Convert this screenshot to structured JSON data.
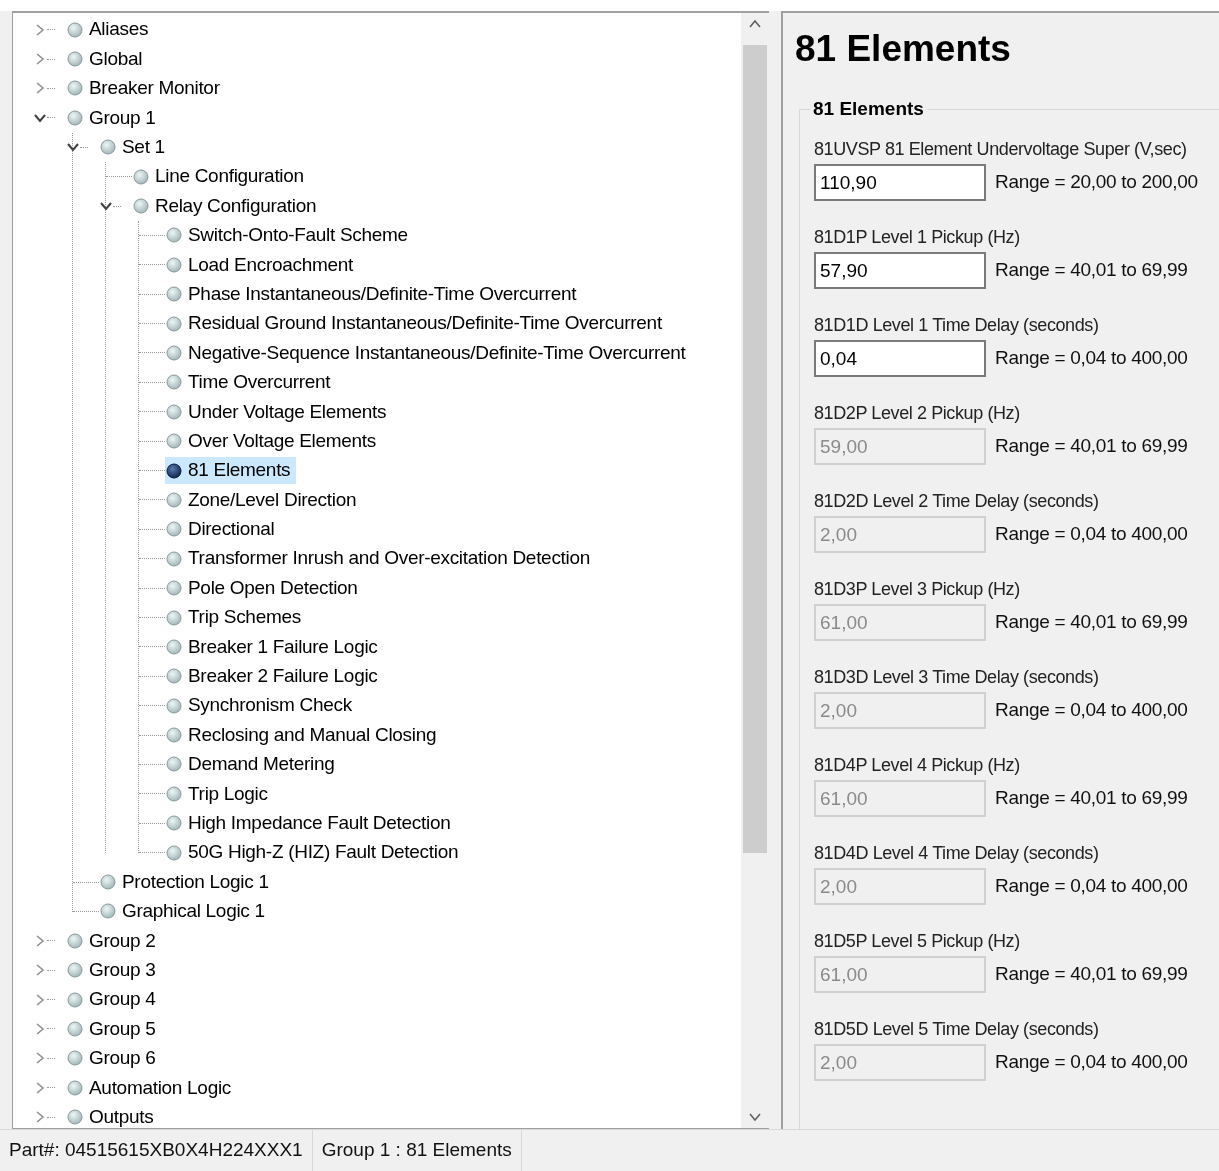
{
  "tree": [
    {
      "label": "Aliases",
      "expanded": false,
      "selected": false
    },
    {
      "label": "Global",
      "expanded": false,
      "selected": false
    },
    {
      "label": "Breaker Monitor",
      "expanded": false,
      "selected": false
    },
    {
      "label": "Group 1",
      "expanded": true,
      "selected": false,
      "children": [
        {
          "label": "Set 1",
          "expanded": true,
          "selected": false,
          "children": [
            {
              "label": "Line Configuration",
              "selected": false
            },
            {
              "label": "Relay Configuration",
              "expanded": true,
              "selected": false,
              "children": [
                {
                  "label": "Switch-Onto-Fault Scheme",
                  "selected": false
                },
                {
                  "label": "Load Encroachment",
                  "selected": false
                },
                {
                  "label": "Phase Instantaneous/Definite-Time Overcurrent",
                  "selected": false
                },
                {
                  "label": "Residual Ground Instantaneous/Definite-Time Overcurrent",
                  "selected": false
                },
                {
                  "label": "Negative-Sequence Instantaneous/Definite-Time Overcurrent",
                  "selected": false
                },
                {
                  "label": "Time Overcurrent",
                  "selected": false
                },
                {
                  "label": "Under Voltage Elements",
                  "selected": false
                },
                {
                  "label": "Over Voltage Elements",
                  "selected": false
                },
                {
                  "label": "81 Elements",
                  "selected": true
                },
                {
                  "label": "Zone/Level Direction",
                  "selected": false
                },
                {
                  "label": "Directional",
                  "selected": false
                },
                {
                  "label": "Transformer Inrush and Over-excitation Detection",
                  "selected": false
                },
                {
                  "label": "Pole Open Detection",
                  "selected": false
                },
                {
                  "label": "Trip Schemes",
                  "selected": false
                },
                {
                  "label": "Breaker 1 Failure Logic",
                  "selected": false
                },
                {
                  "label": "Breaker 2 Failure Logic",
                  "selected": false
                },
                {
                  "label": "Synchronism Check",
                  "selected": false
                },
                {
                  "label": "Reclosing and Manual Closing",
                  "selected": false
                },
                {
                  "label": "Demand Metering",
                  "selected": false
                },
                {
                  "label": "Trip Logic",
                  "selected": false
                },
                {
                  "label": "High Impedance Fault Detection",
                  "selected": false
                },
                {
                  "label": "50G High-Z (HIZ) Fault Detection",
                  "selected": false
                }
              ]
            }
          ]
        },
        {
          "label": "Protection Logic 1",
          "selected": false
        },
        {
          "label": "Graphical Logic 1",
          "selected": false
        }
      ]
    },
    {
      "label": "Group 2",
      "expanded": false,
      "selected": false
    },
    {
      "label": "Group 3",
      "expanded": false,
      "selected": false
    },
    {
      "label": "Group 4",
      "expanded": false,
      "selected": false
    },
    {
      "label": "Group 5",
      "expanded": false,
      "selected": false
    },
    {
      "label": "Group 6",
      "expanded": false,
      "selected": false
    },
    {
      "label": "Automation Logic",
      "expanded": false,
      "selected": false
    },
    {
      "label": "Outputs",
      "expanded": false,
      "selected": false
    }
  ],
  "panel": {
    "title": "81 Elements",
    "group_title": "81 Elements",
    "fields": [
      {
        "code": "81UVSP",
        "label": "81 Element Undervoltage Super (V,sec)",
        "value": "110,90",
        "range": "Range = 20,00 to 200,00",
        "disabled": false
      },
      {
        "code": "81D1P",
        "label": "Level 1 Pickup (Hz)",
        "value": "57,90",
        "range": "Range = 40,01 to 69,99",
        "disabled": false
      },
      {
        "code": "81D1D",
        "label": "Level 1 Time Delay (seconds)",
        "value": "0,04",
        "range": "Range = 0,04 to 400,00",
        "disabled": false
      },
      {
        "code": "81D2P",
        "label": "Level 2 Pickup (Hz)",
        "value": "59,00",
        "range": "Range = 40,01 to 69,99",
        "disabled": true
      },
      {
        "code": "81D2D",
        "label": "Level 2 Time Delay (seconds)",
        "value": "2,00",
        "range": "Range = 0,04 to 400,00",
        "disabled": true
      },
      {
        "code": "81D3P",
        "label": "Level 3 Pickup (Hz)",
        "value": "61,00",
        "range": "Range = 40,01 to 69,99",
        "disabled": true
      },
      {
        "code": "81D3D",
        "label": "Level 3 Time Delay (seconds)",
        "value": "2,00",
        "range": "Range = 0,04 to 400,00",
        "disabled": true
      },
      {
        "code": "81D4P",
        "label": "Level 4 Pickup (Hz)",
        "value": "61,00",
        "range": "Range = 40,01 to 69,99",
        "disabled": true
      },
      {
        "code": "81D4D",
        "label": "Level 4 Time Delay (seconds)",
        "value": "2,00",
        "range": "Range = 0,04 to 400,00",
        "disabled": true
      },
      {
        "code": "81D5P",
        "label": "Level 5 Pickup (Hz)",
        "value": "61,00",
        "range": "Range = 40,01 to 69,99",
        "disabled": true
      },
      {
        "code": "81D5D",
        "label": "Level 5 Time Delay (seconds)",
        "value": "2,00",
        "range": "Range = 0,04 to 400,00",
        "disabled": true
      }
    ]
  },
  "status_bar": [
    "Part#: 04515615XB0X4H224XXX1",
    "Group 1 : 81 Elements"
  ]
}
